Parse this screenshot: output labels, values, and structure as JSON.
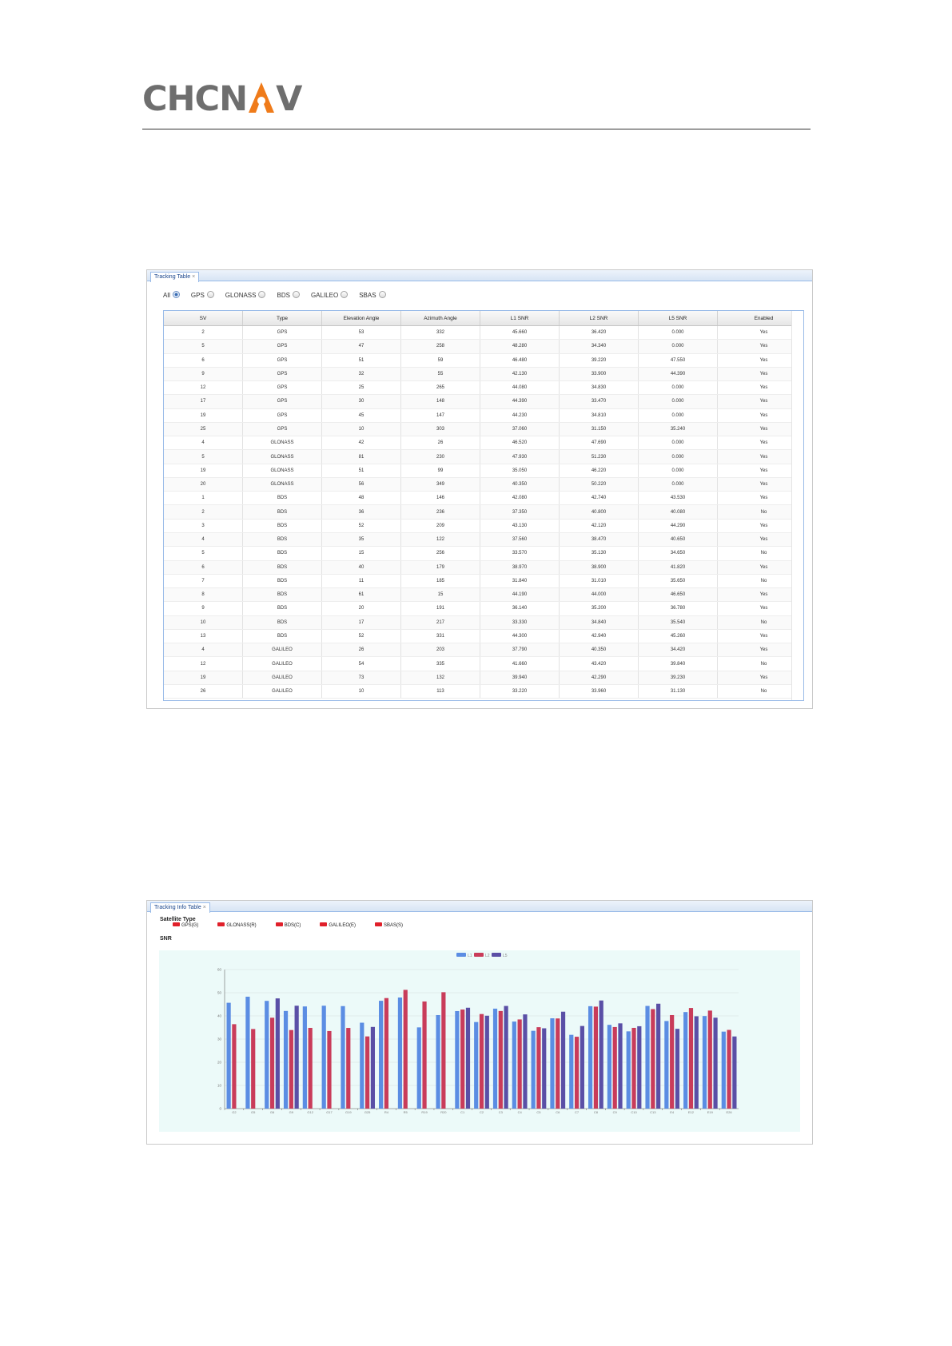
{
  "brand": {
    "logo_text_a": "CHCN",
    "logo_text_b": "V",
    "logo_mark": "letter-a-location-pin-mark"
  },
  "colors": {
    "logo_gray": "#6e6e6e",
    "logo_orange": "#ef7b1a",
    "l1": "#5b8de3",
    "l2": "#c93c5a",
    "l5": "#5a4fa6",
    "sat_type_red": "#e0202a"
  },
  "tracking_table": {
    "tab_label": "Tracking Table",
    "tab_close": "×",
    "filters": [
      {
        "label": "All",
        "checked": true
      },
      {
        "label": "GPS",
        "checked": false
      },
      {
        "label": "GLONASS",
        "checked": false
      },
      {
        "label": "BDS",
        "checked": false
      },
      {
        "label": "GALILEO",
        "checked": false
      },
      {
        "label": "SBAS",
        "checked": false
      }
    ],
    "columns": [
      "SV",
      "Type",
      "Elevation Angle",
      "Azimuth Angle",
      "L1 SNR",
      "L2 SNR",
      "L5 SNR",
      "Enabled"
    ],
    "rows": [
      [
        "2",
        "GPS",
        "53",
        "332",
        "45.660",
        "36.420",
        "0.000",
        "Yes"
      ],
      [
        "5",
        "GPS",
        "47",
        "258",
        "48.280",
        "34.340",
        "0.000",
        "Yes"
      ],
      [
        "6",
        "GPS",
        "51",
        "59",
        "46.480",
        "39.220",
        "47.550",
        "Yes"
      ],
      [
        "9",
        "GPS",
        "32",
        "55",
        "42.130",
        "33.900",
        "44.390",
        "Yes"
      ],
      [
        "12",
        "GPS",
        "25",
        "265",
        "44.080",
        "34.830",
        "0.000",
        "Yes"
      ],
      [
        "17",
        "GPS",
        "30",
        "148",
        "44.390",
        "33.470",
        "0.000",
        "Yes"
      ],
      [
        "19",
        "GPS",
        "45",
        "147",
        "44.230",
        "34.810",
        "0.000",
        "Yes"
      ],
      [
        "25",
        "GPS",
        "10",
        "303",
        "37.060",
        "31.150",
        "35.240",
        "Yes"
      ],
      [
        "4",
        "GLONASS",
        "42",
        "26",
        "46.520",
        "47.690",
        "0.000",
        "Yes"
      ],
      [
        "5",
        "GLONASS",
        "81",
        "230",
        "47.930",
        "51.230",
        "0.000",
        "Yes"
      ],
      [
        "19",
        "GLONASS",
        "51",
        "99",
        "35.050",
        "46.220",
        "0.000",
        "Yes"
      ],
      [
        "20",
        "GLONASS",
        "56",
        "349",
        "40.350",
        "50.220",
        "0.000",
        "Yes"
      ],
      [
        "1",
        "BDS",
        "48",
        "146",
        "42.080",
        "42.740",
        "43.530",
        "Yes"
      ],
      [
        "2",
        "BDS",
        "36",
        "236",
        "37.350",
        "40.800",
        "40.080",
        "No"
      ],
      [
        "3",
        "BDS",
        "52",
        "209",
        "43.130",
        "42.120",
        "44.290",
        "Yes"
      ],
      [
        "4",
        "BDS",
        "35",
        "122",
        "37.560",
        "38.470",
        "40.650",
        "Yes"
      ],
      [
        "5",
        "BDS",
        "15",
        "256",
        "33.570",
        "35.130",
        "34.650",
        "No"
      ],
      [
        "6",
        "BDS",
        "40",
        "179",
        "38.970",
        "38.900",
        "41.820",
        "Yes"
      ],
      [
        "7",
        "BDS",
        "11",
        "185",
        "31.840",
        "31.010",
        "35.650",
        "No"
      ],
      [
        "8",
        "BDS",
        "61",
        "15",
        "44.190",
        "44.000",
        "46.650",
        "Yes"
      ],
      [
        "9",
        "BDS",
        "20",
        "191",
        "36.140",
        "35.200",
        "36.780",
        "Yes"
      ],
      [
        "10",
        "BDS",
        "17",
        "217",
        "33.330",
        "34.840",
        "35.540",
        "No"
      ],
      [
        "13",
        "BDS",
        "52",
        "331",
        "44.300",
        "42.940",
        "45.260",
        "Yes"
      ],
      [
        "4",
        "GALILEO",
        "26",
        "203",
        "37.790",
        "40.350",
        "34.420",
        "Yes"
      ],
      [
        "12",
        "GALILEO",
        "54",
        "335",
        "41.660",
        "43.420",
        "39.840",
        "No"
      ],
      [
        "19",
        "GALILEO",
        "73",
        "132",
        "39.940",
        "42.290",
        "39.230",
        "Yes"
      ],
      [
        "26",
        "GALILEO",
        "10",
        "113",
        "33.220",
        "33.960",
        "31.130",
        "No"
      ]
    ]
  },
  "tracking_info": {
    "tab_label": "Tracking Info Table",
    "tab_close": "×",
    "satellite_type_title": "Satellite Type",
    "satellite_types": [
      "GPS(G)",
      "GLONASS(R)",
      "BDS(C)",
      "GALILEO(E)",
      "SBAS(S)"
    ],
    "snr_title": "SNR"
  },
  "chart_data": {
    "type": "bar",
    "title": "",
    "xlabel": "",
    "ylabel": "",
    "ylim": [
      0,
      60
    ],
    "yticks": [
      0,
      10,
      20,
      30,
      40,
      50,
      60
    ],
    "grid": true,
    "legend_position": "top-center",
    "legend": [
      "L1",
      "L2",
      "L5"
    ],
    "categories": [
      "G2",
      "G5",
      "G6",
      "G9",
      "G12",
      "G17",
      "G19",
      "G25",
      "R4",
      "R5",
      "R19",
      "R20",
      "C1",
      "C2",
      "C3",
      "C4",
      "C5",
      "C6",
      "C7",
      "C8",
      "C9",
      "C10",
      "C13",
      "E4",
      "E12",
      "E19",
      "E26"
    ],
    "series": [
      {
        "name": "L1",
        "color": "#5b8de3",
        "values": [
          45.66,
          48.28,
          46.48,
          42.13,
          44.08,
          44.39,
          44.23,
          37.06,
          46.52,
          47.93,
          35.05,
          40.35,
          42.08,
          37.35,
          43.13,
          37.56,
          33.57,
          38.97,
          31.84,
          44.19,
          36.14,
          33.33,
          44.3,
          37.79,
          41.66,
          39.94,
          33.22
        ]
      },
      {
        "name": "L2",
        "color": "#c93c5a",
        "values": [
          36.42,
          34.34,
          39.22,
          33.9,
          34.83,
          33.47,
          34.81,
          31.15,
          47.69,
          51.23,
          46.22,
          50.22,
          42.74,
          40.8,
          42.12,
          38.47,
          35.13,
          38.9,
          31.01,
          44.0,
          35.2,
          34.84,
          42.94,
          40.35,
          43.42,
          42.29,
          33.96
        ]
      },
      {
        "name": "L5",
        "color": "#5a4fa6",
        "values": [
          0,
          0,
          47.55,
          44.39,
          0,
          0,
          0,
          35.24,
          0,
          0,
          0,
          0,
          43.53,
          40.08,
          44.29,
          40.65,
          34.65,
          41.82,
          35.65,
          46.65,
          36.78,
          35.54,
          45.26,
          34.42,
          39.84,
          39.23,
          31.13
        ]
      }
    ]
  }
}
